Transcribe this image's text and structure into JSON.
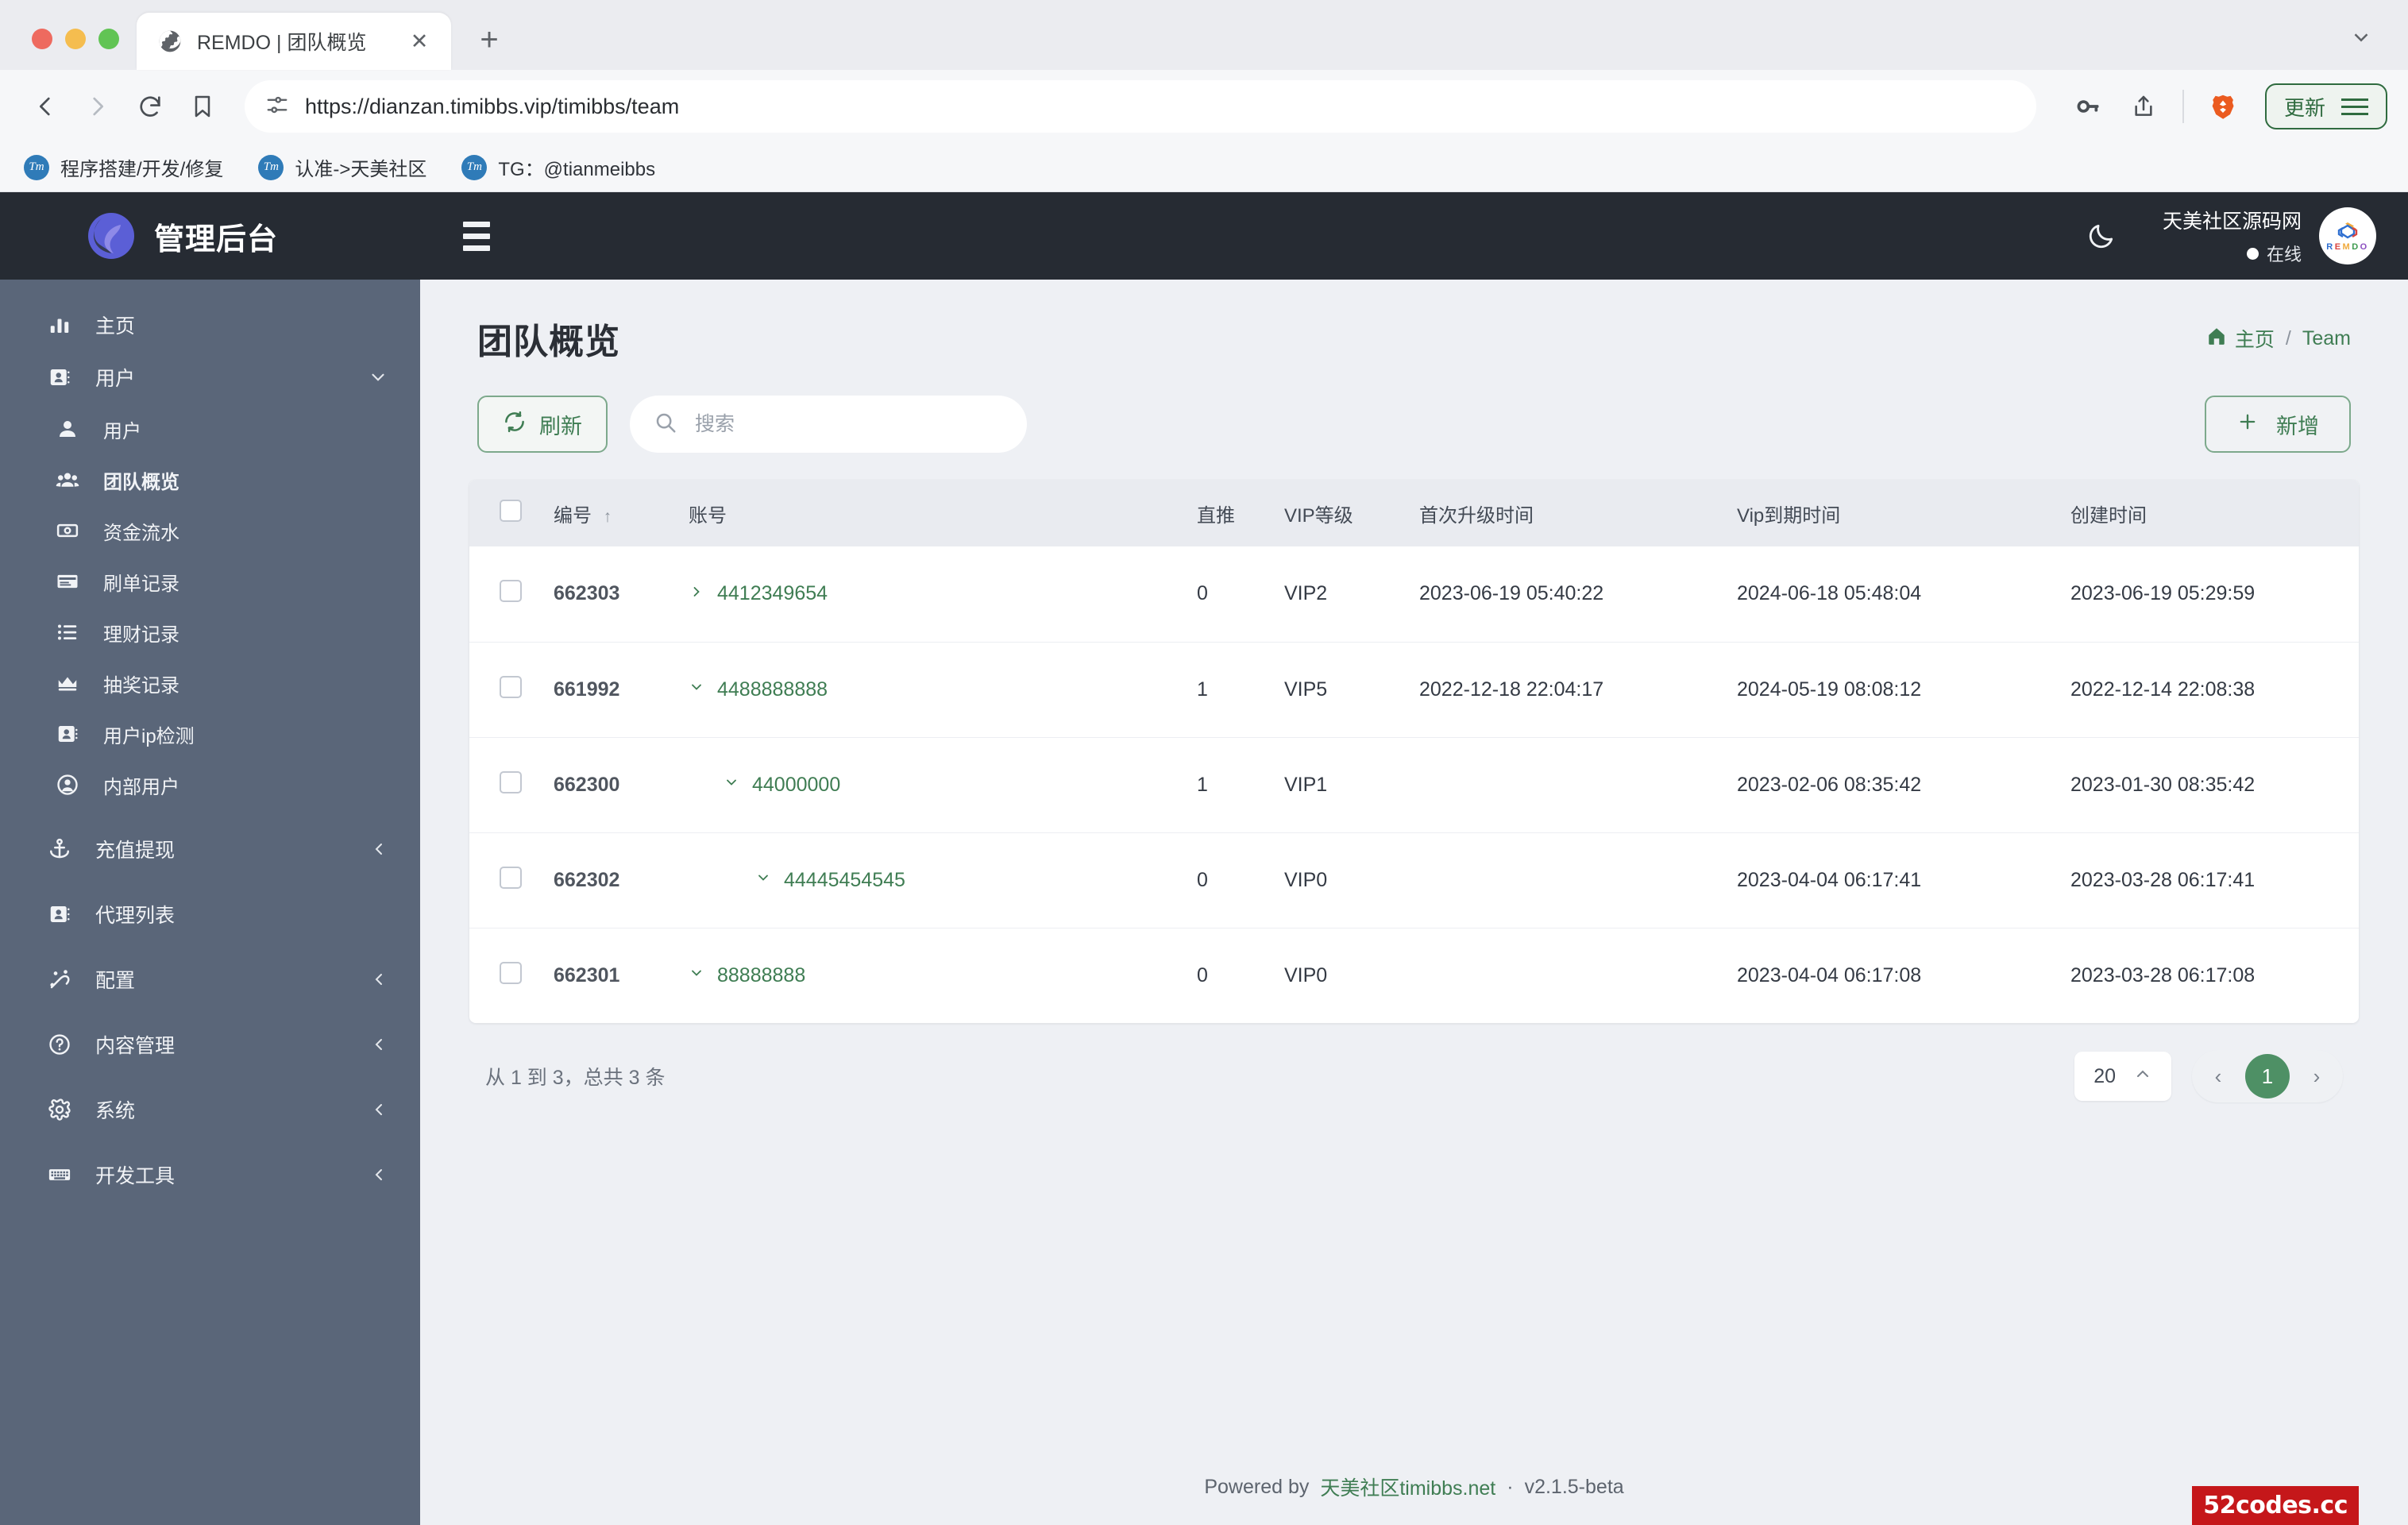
{
  "browser": {
    "tab": {
      "title": "REMDO | 团队概览",
      "favicon": "globe-icon",
      "close": "✕"
    },
    "new_tab": "+",
    "address": {
      "scheme": "https://",
      "host": "dianzan.timibbs.vip",
      "path": "/timibbs/team",
      "full": "https://dianzan.timibbs.vip/timibbs/team"
    },
    "update_button": "更新",
    "bookmarks": [
      {
        "label": "程序搭建/开发/修复",
        "icon": "Tm"
      },
      {
        "label": "认准->天美社区",
        "icon": "Tm"
      },
      {
        "label": "TG：@tianmeibbs",
        "icon": "Tm"
      }
    ]
  },
  "sidebar": {
    "brand": "管理后台",
    "items": [
      {
        "label": "主页",
        "icon": "chart-bar-icon",
        "level": 0,
        "chev": "",
        "active": false
      },
      {
        "label": "用户",
        "icon": "id-card-icon",
        "level": 0,
        "chev": "⌄",
        "active": false
      },
      {
        "label": "用户",
        "icon": "user-icon",
        "level": 1,
        "chev": "",
        "active": false
      },
      {
        "label": "团队概览",
        "icon": "users-group-icon",
        "level": 1,
        "chev": "",
        "active": true
      },
      {
        "label": "资金流水",
        "icon": "money-bill-icon",
        "level": 1,
        "chev": "",
        "active": false
      },
      {
        "label": "刷单记录",
        "icon": "credit-card-icon",
        "level": 1,
        "chev": "",
        "active": false
      },
      {
        "label": "理财记录",
        "icon": "list-icon",
        "level": 1,
        "chev": "",
        "active": false
      },
      {
        "label": "抽奖记录",
        "icon": "crown-icon",
        "level": 1,
        "chev": "",
        "active": false
      },
      {
        "label": "用户ip检测",
        "icon": "id-badge-icon",
        "level": 1,
        "chev": "",
        "active": false
      },
      {
        "label": "内部用户",
        "icon": "user-circle-icon",
        "level": 1,
        "chev": "",
        "active": false
      },
      {
        "label": "充值提现",
        "icon": "anchor-icon",
        "level": 0,
        "chev": "‹",
        "active": false
      },
      {
        "label": "代理列表",
        "icon": "id-card-icon",
        "level": 0,
        "chev": "",
        "active": false
      },
      {
        "label": "配置",
        "icon": "magic-wand-icon",
        "level": 0,
        "chev": "‹",
        "active": false
      },
      {
        "label": "内容管理",
        "icon": "question-circle-icon",
        "level": 0,
        "chev": "‹",
        "active": false
      },
      {
        "label": "系统",
        "icon": "gear-icon",
        "level": 0,
        "chev": "‹",
        "active": false
      },
      {
        "label": "开发工具",
        "icon": "keyboard-icon",
        "level": 0,
        "chev": "‹",
        "active": false
      }
    ]
  },
  "appbar": {
    "menu_toggle": "hamburger-icon",
    "theme_toggle": "moon-icon",
    "user_name": "天美社区源码网",
    "user_status": "在线",
    "avatar_text": "REMDO"
  },
  "page": {
    "title": "团队概览",
    "breadcrumb": {
      "home": "主页",
      "sep": "/",
      "current": "Team"
    }
  },
  "toolbar": {
    "refresh_label": "刷新",
    "search_placeholder": "搜索",
    "search_value": "",
    "add_label": "新增",
    "add_icon": "plus-icon"
  },
  "table": {
    "columns": [
      "编号",
      "账号",
      "直推",
      "VIP等级",
      "首次升级时间",
      "Vip到期时间",
      "创建时间"
    ],
    "sort_column": "编号",
    "sort_dir": "↑",
    "rows": [
      {
        "id": "662303",
        "chev": "›",
        "account": "4412349654",
        "indent": 1,
        "direct": "0",
        "vip": "VIP2",
        "first_upgrade": "2023-06-19 05:40:22",
        "vip_expire": "2024-06-18 05:48:04",
        "created": "2023-06-19 05:29:59"
      },
      {
        "id": "661992",
        "chev": "⌄",
        "account": "4488888888",
        "indent": 1,
        "direct": "1",
        "vip": "VIP5",
        "first_upgrade": "2022-12-18 22:04:17",
        "vip_expire": "2024-05-19 08:08:12",
        "created": "2022-12-14 22:08:38"
      },
      {
        "id": "662300",
        "chev": "⌄",
        "account": "44000000",
        "indent": 2,
        "direct": "1",
        "vip": "VIP1",
        "first_upgrade": "",
        "vip_expire": "2023-02-06 08:35:42",
        "created": "2023-01-30 08:35:42"
      },
      {
        "id": "662302",
        "chev": "⌄",
        "account": "44445454545",
        "indent": 3,
        "direct": "0",
        "vip": "VIP0",
        "first_upgrade": "",
        "vip_expire": "2023-04-04 06:17:41",
        "created": "2023-03-28 06:17:41"
      },
      {
        "id": "662301",
        "chev": "⌄",
        "account": "88888888",
        "indent": 1,
        "direct": "0",
        "vip": "VIP0",
        "first_upgrade": "",
        "vip_expire": "2023-04-04 06:17:08",
        "created": "2023-03-28 06:17:08"
      }
    ]
  },
  "pagination": {
    "info": "从 1 到 3，总共 3 条",
    "page_size": "20",
    "page_size_chev": "⌃",
    "prev": "‹",
    "next": "›",
    "current_page": "1"
  },
  "footer": {
    "powered_prefix": "Powered by",
    "link": "天美社区timibbs.net",
    "sep": "·",
    "version": "v2.1.5-beta",
    "watermark": "52codes.cc"
  },
  "colors": {
    "sidebar": "#5a6679",
    "appbar": "#262b33",
    "accent_green": "#3f7d53",
    "page_bg": "#eef0f4",
    "pager_active": "#4e9065",
    "watermark_red": "#c5171a"
  }
}
